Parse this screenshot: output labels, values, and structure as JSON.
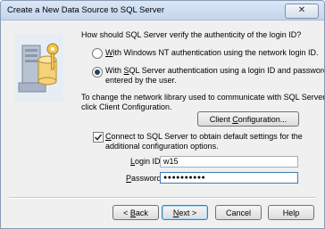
{
  "window": {
    "title": "Create a New Data Source to SQL Server",
    "close_glyph": "✕"
  },
  "question": "How should SQL Server verify the authenticity of the login ID?",
  "radios": [
    {
      "pre": "",
      "accel": "W",
      "post": "ith Windows NT authentication using the network login ID.",
      "checked": false
    },
    {
      "pre": "With ",
      "accel": "S",
      "post": "QL Server authentication using a login ID and password",
      "line2": "entered by the user.",
      "checked": true
    }
  ],
  "network_note": {
    "line1": "To change the network library used to communicate with SQL Server,",
    "line2": "click Client Configuration."
  },
  "client_config_button": {
    "pre": "Client ",
    "accel": "C",
    "post": "onfiguration..."
  },
  "connect_checkbox": {
    "checked": true,
    "pre": "",
    "accel": "C",
    "post": "onnect to SQL Server to obtain default settings for the",
    "line2": "additional configuration options."
  },
  "login": {
    "pre": "",
    "accel": "L",
    "post": "ogin ID:",
    "value": "w15"
  },
  "password": {
    "pre": "",
    "accel": "P",
    "post": "assword:",
    "value": "●●●●●●●●●●"
  },
  "buttons": {
    "back": {
      "pre": "< ",
      "accel": "B",
      "post": "ack"
    },
    "next": {
      "pre": "",
      "accel": "N",
      "post": "ext >"
    },
    "cancel": {
      "label": "Cancel"
    },
    "help": {
      "label": "Help"
    }
  },
  "icons": {
    "wizard": "server-database-key-icon"
  }
}
